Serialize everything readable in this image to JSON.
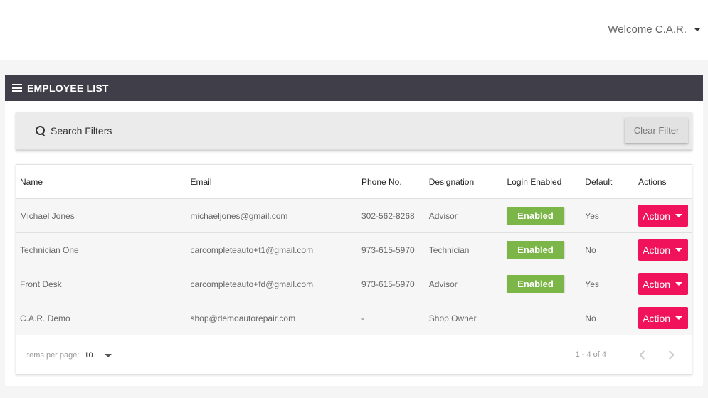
{
  "header": {
    "welcome_text": "Welcome C.A.R."
  },
  "panel": {
    "title": "EMPLOYEE LIST"
  },
  "filters": {
    "search_label": "Search Filters",
    "clear_label": "Clear Filter"
  },
  "table": {
    "columns": [
      "Name",
      "Email",
      "Phone No.",
      "Designation",
      "Login Enabled",
      "Default",
      "Actions"
    ],
    "rows": [
      {
        "name": "Michael Jones",
        "email": "michaeljones@gmail.com",
        "phone": "302-562-8268",
        "designation": "Advisor",
        "login": "Enabled",
        "default": "Yes",
        "action": "Action"
      },
      {
        "name": "Technician One",
        "email": "carcompleteauto+t1@gmail.com",
        "phone": "973-615-5970",
        "designation": "Technician",
        "login": "Enabled",
        "default": "No",
        "action": "Action"
      },
      {
        "name": "Front Desk",
        "email": "carcompleteauto+fd@gmail.com",
        "phone": "973-615-5970",
        "designation": "Advisor",
        "login": "Enabled",
        "default": "Yes",
        "action": "Action"
      },
      {
        "name": "C.A.R. Demo",
        "email": "shop@demoautorepair.com",
        "phone": "-",
        "designation": "Shop Owner",
        "login": "",
        "default": "No",
        "action": "Action"
      }
    ]
  },
  "paginator": {
    "items_per_page_label": "Items per page:",
    "items_per_page_value": "10",
    "range_label": "1 - 4 of 4"
  },
  "colors": {
    "header_bar": "#3f3e49",
    "enabled_green": "#7db648",
    "action_pink": "#f0135c"
  },
  "icons": {
    "menu": "hamburger-icon",
    "search": "search-icon",
    "dropdown": "chevron-down-icon",
    "prev": "chevron-left-icon",
    "next": "chevron-right-icon"
  }
}
